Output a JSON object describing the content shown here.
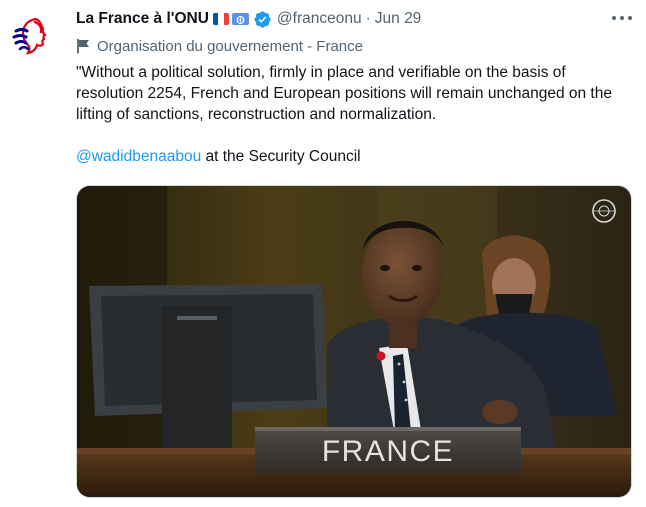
{
  "tweet": {
    "display_name": "La France à l'ONU",
    "handle": "@franceonu",
    "separator": "·",
    "date": "Jun 29",
    "affiliation": "Organisation du gouvernement - France",
    "text": "\"Without a political solution, firmly in place and verifiable on the basis of resolution 2254, French and European positions will remain unchanged on the lifting of sanctions, reconstruction and normalization.",
    "mention": "@wadidbenaabou",
    "mention_suffix": " at the Security Council"
  },
  "media": {
    "nameplate": "FRANCE"
  },
  "icons": {
    "avatar": "marianne-logo-icon",
    "flag1": "france-flag-icon",
    "flag2": "united-nations-flag-icon",
    "verified": "verified-badge-icon",
    "more": "more-options-icon",
    "affiliation": "flag-icon"
  },
  "colors": {
    "accent": "#1d9bf0",
    "muted": "#536471",
    "text": "#0f1419"
  }
}
